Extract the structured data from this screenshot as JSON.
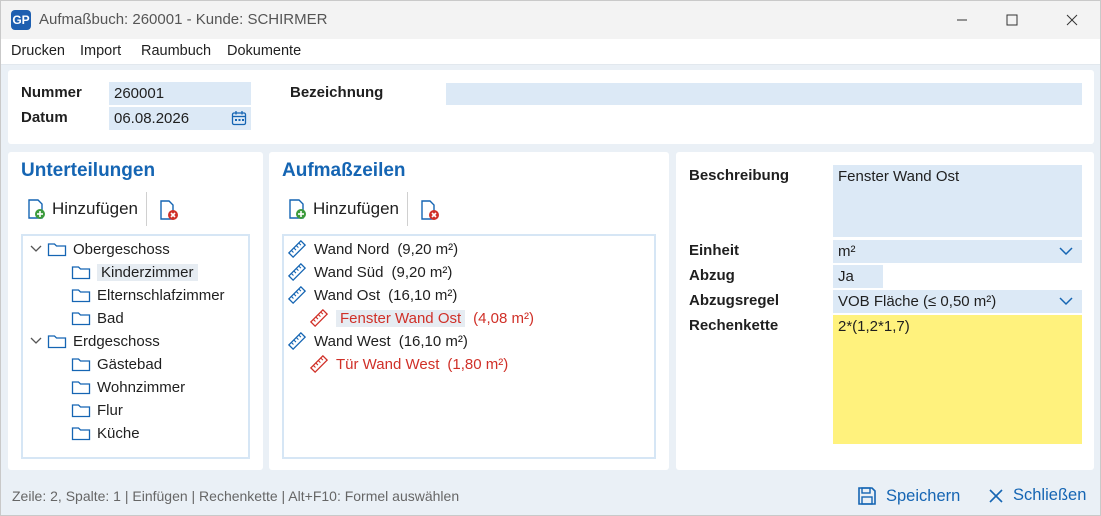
{
  "window": {
    "title": "Aufmaßbuch: 260001 - Kunde: SCHIRMER",
    "app_icon_text": "GP"
  },
  "menu": [
    "Drucken",
    "Import",
    "Raumbuch",
    "Dokumente"
  ],
  "header": {
    "nummer_label": "Nummer",
    "nummer_value": "260001",
    "datum_label": "Datum",
    "datum_value": "06.08.2026",
    "bezeichnung_label": "Bezeichnung",
    "bezeichnung_value": ""
  },
  "unterteilungen": {
    "title": "Unterteilungen",
    "add_label": "Hinzufügen",
    "tree": [
      {
        "label": "Obergeschoss",
        "level": 0,
        "expanded": true,
        "selected": false
      },
      {
        "label": "Kinderzimmer",
        "level": 1,
        "selected": true
      },
      {
        "label": "Elternschlafzimmer",
        "level": 1,
        "selected": false
      },
      {
        "label": "Bad",
        "level": 1,
        "selected": false
      },
      {
        "label": "Erdgeschoss",
        "level": 0,
        "expanded": true,
        "selected": false
      },
      {
        "label": "Gästebad",
        "level": 1,
        "selected": false
      },
      {
        "label": "Wohnzimmer",
        "level": 1,
        "selected": false
      },
      {
        "label": "Flur",
        "level": 1,
        "selected": false
      },
      {
        "label": "Küche",
        "level": 1,
        "selected": false
      }
    ]
  },
  "aufmasszeilen": {
    "title": "Aufmaßzeilen",
    "add_label": "Hinzufügen",
    "rows": [
      {
        "label": "Wand Nord",
        "value": "(9,20 m²)",
        "level": 0,
        "deduction": false,
        "selected": false
      },
      {
        "label": "Wand Süd",
        "value": "(9,20 m²)",
        "level": 0,
        "deduction": false,
        "selected": false
      },
      {
        "label": "Wand Ost",
        "value": "(16,10 m²)",
        "level": 0,
        "deduction": false,
        "selected": false
      },
      {
        "label": "Fenster Wand Ost",
        "value": "(4,08 m²)",
        "level": 1,
        "deduction": true,
        "selected": true
      },
      {
        "label": "Wand West",
        "value": "(16,10 m²)",
        "level": 0,
        "deduction": false,
        "selected": false
      },
      {
        "label": "Tür Wand West",
        "value": "(1,80 m²)",
        "level": 1,
        "deduction": true,
        "selected": false
      }
    ]
  },
  "details": {
    "beschreibung_label": "Beschreibung",
    "beschreibung_value": "Fenster Wand Ost",
    "einheit_label": "Einheit",
    "einheit_value": "m²",
    "abzug_label": "Abzug",
    "abzug_value": "Ja",
    "abzugsregel_label": "Abzugsregel",
    "abzugsregel_value": "VOB Fläche (≤ 0,50 m²)",
    "rechenkette_label": "Rechenkette",
    "rechenkette_value": "2*(1,2*1,7)"
  },
  "status": {
    "text": "Zeile: 2,  Spalte: 1 | Einfügen | Rechenkette | Alt+F10: Formel auswählen",
    "save_label": "Speichern",
    "close_label": "Schließen"
  },
  "colors": {
    "accent": "#1565b3",
    "deduction": "#d03028",
    "field_bg": "#dce9f6",
    "formula_bg": "#fff27d"
  }
}
